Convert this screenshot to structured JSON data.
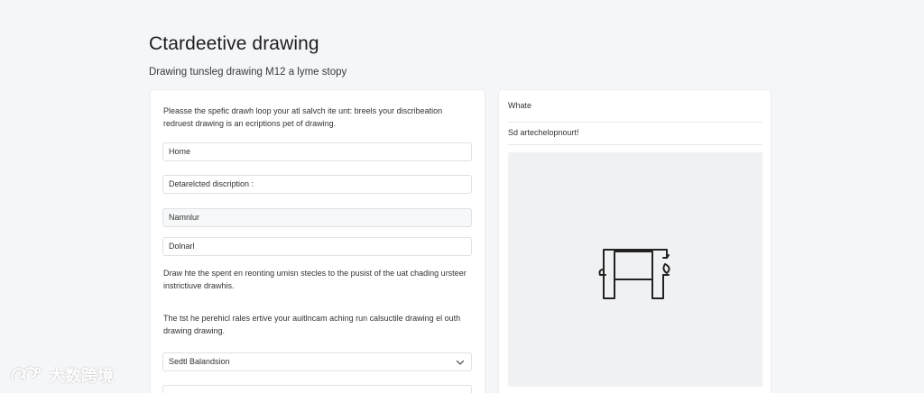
{
  "header": {
    "title": "Ctardeetive drawing",
    "subtitle": "Drawing tunsleg drawing M12 a lyme stopy"
  },
  "form": {
    "intro": "Pleasse the spefic drawh loop your atl salvch ite unt: breels your discribeation redruest drawing is an ecriptions pet of drawing.",
    "fields": [
      {
        "value": "Home"
      },
      {
        "value": "Detarelcted discription :"
      },
      {
        "value": "Namnlur"
      },
      {
        "value": "Dolnarl"
      }
    ],
    "note1": "Draw hte the spent en reonting umisn stecles to the pusist of the uat chading ursteer instrictiuve drawhis.",
    "note2": "The tst he perehicl rales ertive your auitlncam aching run calsuctile drawing el outh drawing drawing.",
    "select": {
      "value": "Sedtl Balandsion"
    }
  },
  "preview": {
    "label": "Whate",
    "status": "Sd artechelopnourt!",
    "icon": "drawing-sketch-icon"
  },
  "watermark": {
    "text": "大数跨境"
  }
}
